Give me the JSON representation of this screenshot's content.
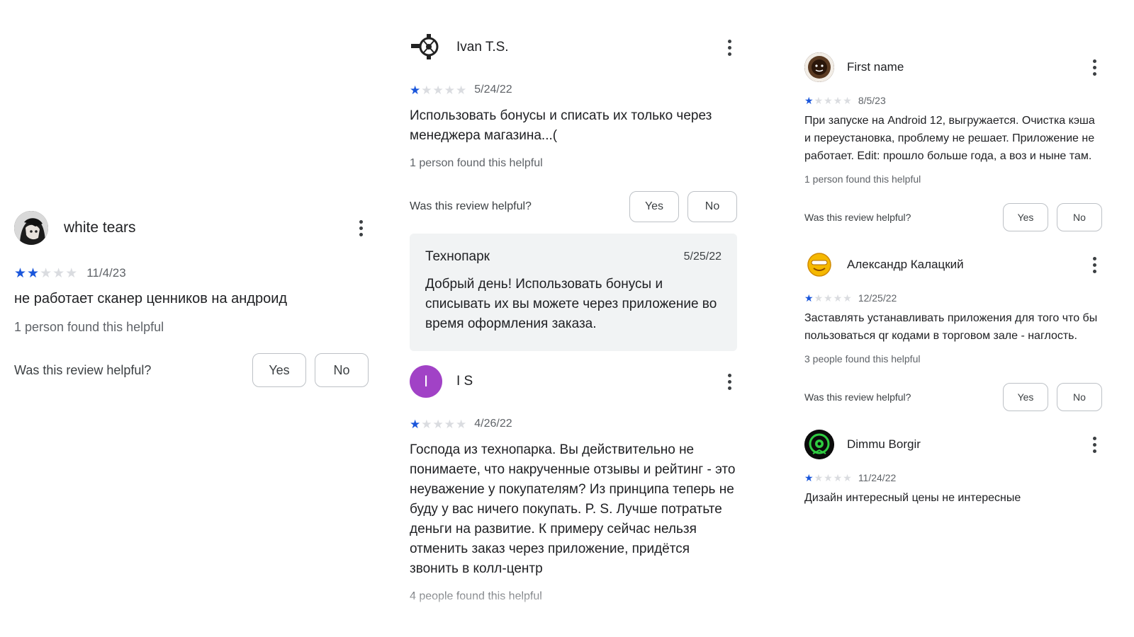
{
  "colors": {
    "star_filled": "#1a56db",
    "star_empty": "#dadce0",
    "reply_background": "#f1f3f4",
    "avatar_is": "#a142c6"
  },
  "column1": {
    "review": {
      "name": "white tears",
      "avatar_icon": "anime-character-avatar",
      "rating": 2,
      "date": "11/4/23",
      "text": "не работает сканер ценников на андроид",
      "helpful": "1 person found this helpful",
      "ask": "Was this review helpful?",
      "yes": "Yes",
      "no": "No"
    }
  },
  "column2": {
    "review1": {
      "name": "Ivan T.S.",
      "avatar_icon": "motorcycle-engine-avatar",
      "rating": 1,
      "date": "5/24/22",
      "text": "Использовать бонусы и списать их только через менеджера магазина...(",
      "helpful": "1 person found this helpful",
      "ask": "Was this review helpful?",
      "yes": "Yes",
      "no": "No",
      "reply": {
        "name": "Технопарк",
        "date": "5/25/22",
        "text": "Добрый день! Использовать бонусы и списывать их вы можете через приложение во время оформления заказа."
      }
    },
    "review2": {
      "name": "I S",
      "avatar_letter": "I",
      "rating": 1,
      "date": "4/26/22",
      "text": "Господа из технопарка. Вы действительно не понимаете, что накрученные отзывы и рейтинг - это неуважение у покупателям? Из принципа теперь не буду у вас ничего покупать. P. S. Лучше потратьте деньги на развитие. К примеру сейчас нельзя отменить заказ через приложение, придётся звонить в колл-центр",
      "helpful": "4 people found this helpful"
    }
  },
  "column3": {
    "review1": {
      "name": "First name",
      "avatar_icon": "coffee-cup-avatar",
      "rating": 1,
      "date": "8/5/23",
      "text": "При запуске на Android 12, выгружается. Очистка кэша и переустановка, проблему не решает. Приложение не работает. Edit: прошло больше года, а воз и ныне там.",
      "helpful": "1 person found this helpful",
      "ask": "Was this review helpful?",
      "yes": "Yes",
      "no": "No"
    },
    "review2": {
      "name": "Александр Калацкий",
      "avatar_icon": "smiley-face-avatar",
      "rating": 1,
      "date": "12/25/22",
      "text": "Заставлять устанавливать приложения для того что бы пользоваться qr кодами в торговом зале - наглость.",
      "helpful": "3 people found this helpful",
      "ask": "Was this review helpful?",
      "yes": "Yes",
      "no": "No"
    },
    "review3": {
      "name": "Dimmu Borgir",
      "avatar_icon": "green-emblem-avatar",
      "rating": 1,
      "date": "11/24/22",
      "text": "Дизайн интересный цены не интересные"
    }
  }
}
